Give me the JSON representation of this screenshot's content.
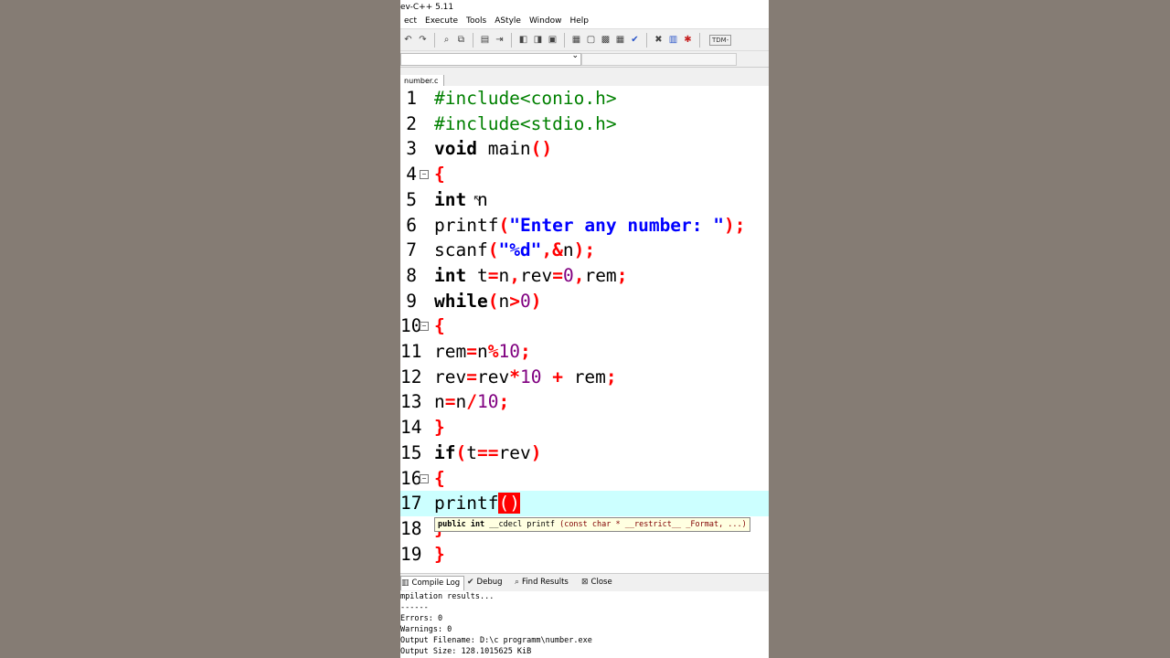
{
  "window": {
    "title": "ev-C++ 5.11"
  },
  "menu": [
    "ect",
    "Execute",
    "Tools",
    "AStyle",
    "Window",
    "Help"
  ],
  "toolbar": {
    "tdm": "TDM-"
  },
  "file_tab": "number.c",
  "code_lines": [
    {
      "n": "1"
    },
    {
      "n": "2"
    },
    {
      "n": "3"
    },
    {
      "n": "4"
    },
    {
      "n": "5"
    },
    {
      "n": "6"
    },
    {
      "n": "7"
    },
    {
      "n": "8"
    },
    {
      "n": "9"
    },
    {
      "n": "10"
    },
    {
      "n": "11"
    },
    {
      "n": "12"
    },
    {
      "n": "13"
    },
    {
      "n": "14"
    },
    {
      "n": "15"
    },
    {
      "n": "16"
    },
    {
      "n": "17"
    },
    {
      "n": "18"
    },
    {
      "n": "19"
    }
  ],
  "code": {
    "l1": "#include<conio.h>",
    "l2": "#include<stdio.h>",
    "l3_kw": "void",
    "l3_rest": " main",
    "l3_sym": "()",
    "l4": "{",
    "l5_kw": "int",
    "l5_rest": " n",
    "l6_fn": "printf",
    "l6_open": "(",
    "l6_str": "\"Enter any number: \"",
    "l6_close": ");",
    "l7_fn": "scanf",
    "l7_open": "(",
    "l7_str": "\"%d\"",
    "l7_a": ",&",
    "l7_n": "n",
    "l7_close": ");",
    "l8_kw": "int",
    "l8_a": " t",
    "l8_b": "=",
    "l8_c": "n",
    "l8_d": ",",
    "l8_e": "rev",
    "l8_f": "=",
    "l8_g": "0",
    "l8_h": ",",
    "l8_i": "rem",
    "l8_j": ";",
    "l9_kw": "while",
    "l9_a": "(",
    "l9_b": "n",
    "l9_c": ">",
    "l9_d": "0",
    "l9_e": ")",
    "l10": "{",
    "l11_a": "rem",
    "l11_b": "=",
    "l11_c": "n",
    "l11_d": "%",
    "l11_e": "10",
    "l11_f": ";",
    "l12_a": "rev",
    "l12_b": "=",
    "l12_c": "rev",
    "l12_d": "*",
    "l12_e": "10",
    "l12_f": " + ",
    "l12_g": "rem",
    "l12_h": ";",
    "l13_a": "n",
    "l13_b": "=",
    "l13_c": "n",
    "l13_d": "/",
    "l13_e": "10",
    "l13_f": ";",
    "l14": "}",
    "l15_kw": "if",
    "l15_a": "(",
    "l15_b": "t",
    "l15_c": "==",
    "l15_d": "rev",
    "l15_e": ")",
    "l16": "{",
    "l17_fn": "printf",
    "l17_err": "()",
    "l18": "}",
    "l19": "}"
  },
  "hint": {
    "a": "public int",
    "b": " __cdecl printf ",
    "c": "(const char * __restrict__ _Format, ...)"
  },
  "bottom_tabs": {
    "compile_log": "Compile Log",
    "debug": "Debug",
    "find_results": "Find Results",
    "close": "Close"
  },
  "log": [
    "mpilation results...",
    "------",
    "Errors: 0",
    "Warnings: 0",
    "Output Filename: D:\\c programm\\number.exe",
    "Output Size: 128.1015625 KiB"
  ]
}
